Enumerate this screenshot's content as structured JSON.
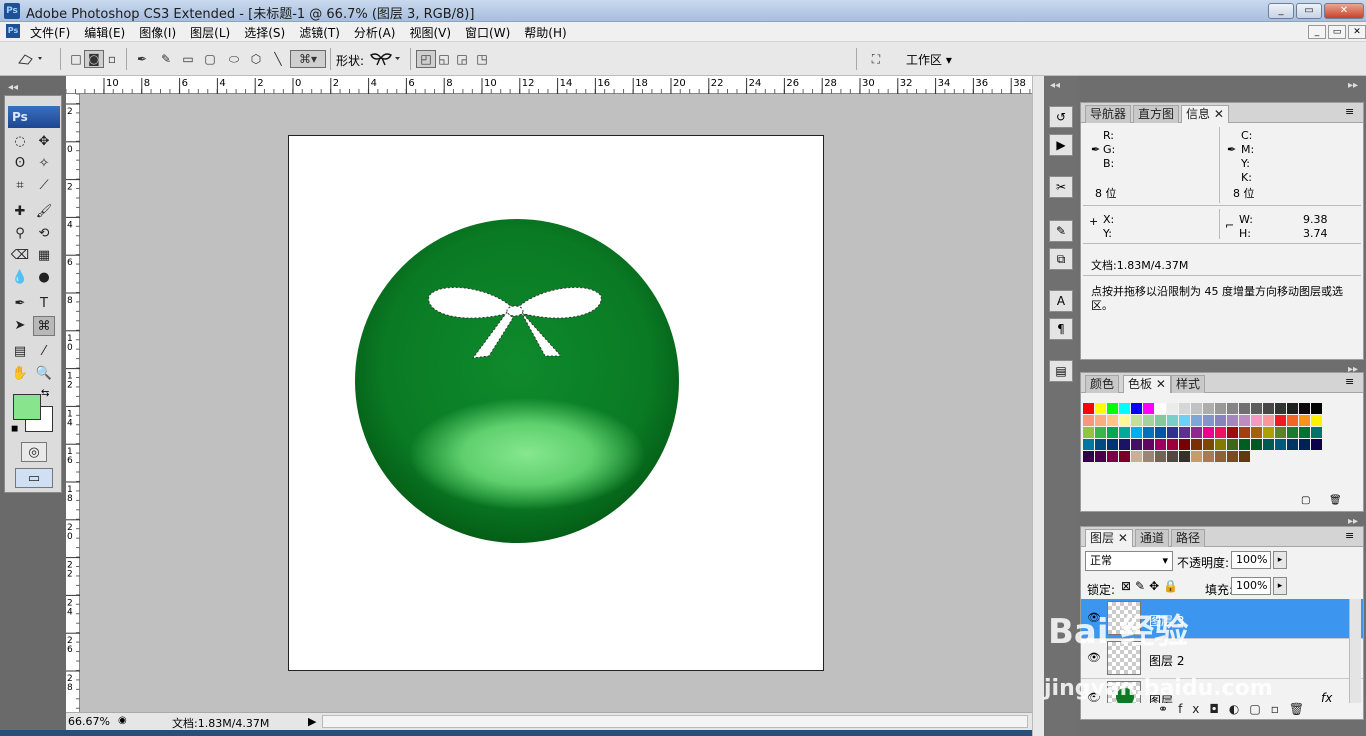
{
  "window": {
    "app_badge": "Ps",
    "title": "Adobe Photoshop CS3 Extended - [未标题-1 @ 66.7% (图层 3, RGB/8)]",
    "controls": {
      "minimize": "_",
      "maximize": "▭",
      "close": "✕"
    },
    "doc_controls": {
      "minimize": "_",
      "restore": "▭",
      "close": "✕"
    }
  },
  "menubar": {
    "items": [
      "文件(F)",
      "编辑(E)",
      "图像(I)",
      "图层(L)",
      "选择(S)",
      "滤镜(T)",
      "分析(A)",
      "视图(V)",
      "窗口(W)",
      "帮助(H)"
    ]
  },
  "options_bar": {
    "shape_label": "形状:",
    "workspace_label": "工作区 ▾"
  },
  "toolbox": {
    "badge": "Ps",
    "foreground_color": "#88e48d",
    "background_color": "#ffffff"
  },
  "ruler": {
    "top_ticks": [
      "10",
      "8",
      "6",
      "4",
      "2",
      "0",
      "2",
      "4",
      "6",
      "8",
      "10",
      "12",
      "14",
      "16",
      "18",
      "20",
      "22",
      "24",
      "26",
      "28",
      "30",
      "32",
      "34",
      "36",
      "38"
    ],
    "left_ticks": [
      "2",
      "0",
      "2",
      "4",
      "6",
      "8",
      "1\n0",
      "1\n2",
      "1\n4",
      "1\n6",
      "1\n8",
      "2\n0",
      "2\n2",
      "2\n4",
      "2\n6",
      "2\n8"
    ]
  },
  "status": {
    "zoom": "66.67%",
    "doc_size": "文档:1.83M/4.37M",
    "arrow": "▶"
  },
  "info_panel": {
    "tabs": [
      "导航器",
      "直方图",
      "信息"
    ],
    "active_tab": "信息",
    "rgb": {
      "r": "R:",
      "g": "G:",
      "b": "B:"
    },
    "cmyk": {
      "c": "C:",
      "m": "M:",
      "y": "Y:",
      "k": "K:"
    },
    "bit_left": "8 位",
    "bit_right": "8 位",
    "x": "X:",
    "y": "Y:",
    "w_label": "W:",
    "w_value": "9.38",
    "h_label": "H:",
    "h_value": "3.74",
    "doc": "文档:1.83M/4.37M",
    "hint": "点按并拖移以沿限制为 45 度增量方向移动图层或选区。"
  },
  "swatches_panel": {
    "tabs": [
      "颜色",
      "色板",
      "样式"
    ],
    "active_tab": "色板",
    "colors": [
      "#ff0000",
      "#ffff00",
      "#00ff00",
      "#00ffff",
      "#0000ff",
      "#ff00ff",
      "#ffffff",
      "#ebebeb",
      "#d6d6d6",
      "#c2c2c2",
      "#adadad",
      "#999999",
      "#858585",
      "#707070",
      "#5c5c5c",
      "#474747",
      "#333333",
      "#1f1f1f",
      "#0a0a0a",
      "#000000",
      "#f7977a",
      "#f9ad81",
      "#fdc68a",
      "#fff79a",
      "#c4df9b",
      "#a2d39c",
      "#82ca9d",
      "#7bcdc8",
      "#6ecff6",
      "#7ea7d8",
      "#8493ca",
      "#8882be",
      "#a187be",
      "#bc8dbf",
      "#f49ac2",
      "#f6989d",
      "#ed1c24",
      "#f26522",
      "#f7941d",
      "#fff200",
      "#8dc63f",
      "#39b54a",
      "#00a651",
      "#00a99d",
      "#00aeef",
      "#0072bc",
      "#0054a6",
      "#2e3192",
      "#662d91",
      "#92278f",
      "#ec008c",
      "#ed145b",
      "#9e0b0f",
      "#a0410d",
      "#a36209",
      "#aba000",
      "#598527",
      "#1a7b30",
      "#007236",
      "#00746b",
      "#0076a3",
      "#004b80",
      "#003471",
      "#1b1464",
      "#440e62",
      "#630460",
      "#9e005d",
      "#9e0039",
      "#790000",
      "#7b2e00",
      "#7d4900",
      "#827b00",
      "#406618",
      "#005e20",
      "#005826",
      "#005952",
      "#005b7f",
      "#003663",
      "#002157",
      "#0d004c",
      "#32004b",
      "#4b0049",
      "#7b0046",
      "#7a0026",
      "#c7b299",
      "#998675",
      "#736357",
      "#534741",
      "#37302d",
      "#c69c6d",
      "#a67c52",
      "#8c6239",
      "#754c24",
      "#603913"
    ]
  },
  "layers_panel": {
    "tabs": [
      "图层",
      "通道",
      "路径"
    ],
    "active_tab": "图层",
    "blend_mode": "正常",
    "opacity_label": "不透明度:",
    "opacity_value": "100%",
    "lock_label": "锁定:",
    "fill_label": "填充:",
    "fill_value": "100%",
    "layers": [
      {
        "name": "图层 3",
        "selected": true
      },
      {
        "name": "图层 2",
        "selected": false
      },
      {
        "name": "图层",
        "selected": false
      }
    ],
    "fx": "fx"
  },
  "watermark": {
    "text": "Bai 经验",
    "sub": "jingyan.baidu.com"
  }
}
